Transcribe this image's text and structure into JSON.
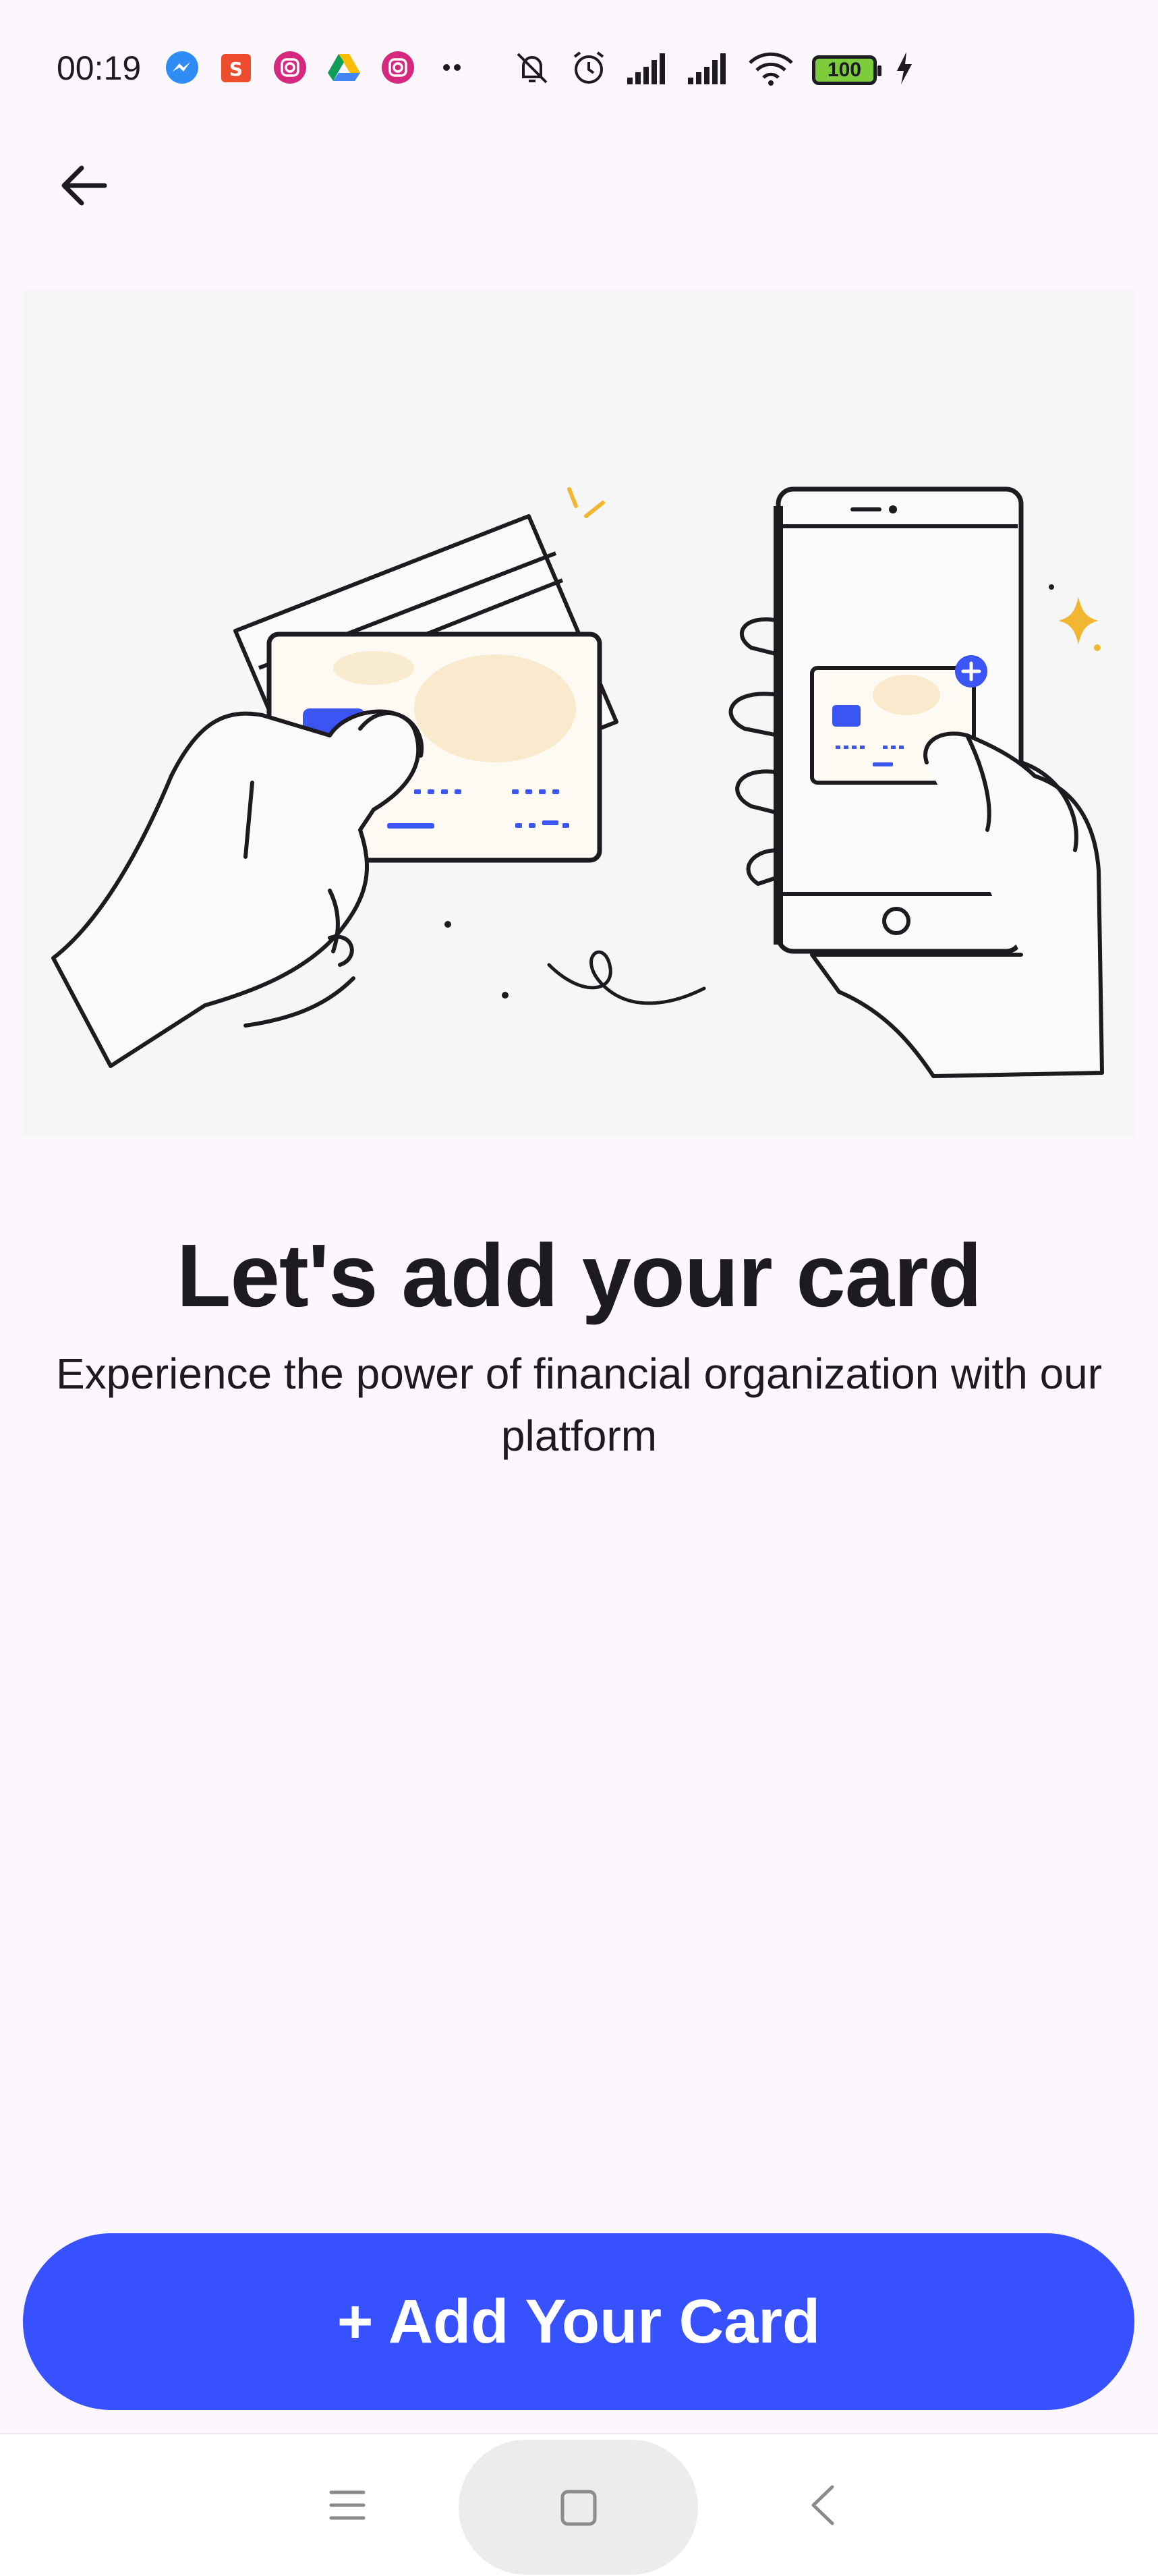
{
  "status_bar": {
    "time": "00:19",
    "battery_level": "100",
    "icons_left": [
      "messenger-icon",
      "shopee-icon",
      "instagram-icon",
      "google-drive-icon",
      "instagram-icon",
      "more-notifications-icon"
    ],
    "icons_right": [
      "muted-bell-icon",
      "alarm-icon",
      "signal-icon",
      "signal-icon",
      "wifi-icon",
      "battery-icon",
      "charging-icon"
    ]
  },
  "header": {
    "back_icon": "arrow-left-icon"
  },
  "content": {
    "title": "Let's add your card",
    "subtitle": "Experience the power of financial organization with our platform",
    "illustration": "hands-holding-cards-and-phone-illustration"
  },
  "footer": {
    "add_card_label": "+ Add Your Card",
    "button_color": "#3851ff"
  },
  "nav_bar": {
    "items": [
      "menu-icon",
      "home-icon",
      "back-chevron-icon"
    ]
  },
  "colors": {
    "background": "#fcf7fd",
    "accent": "#3851ff",
    "text": "#1d1b20"
  }
}
